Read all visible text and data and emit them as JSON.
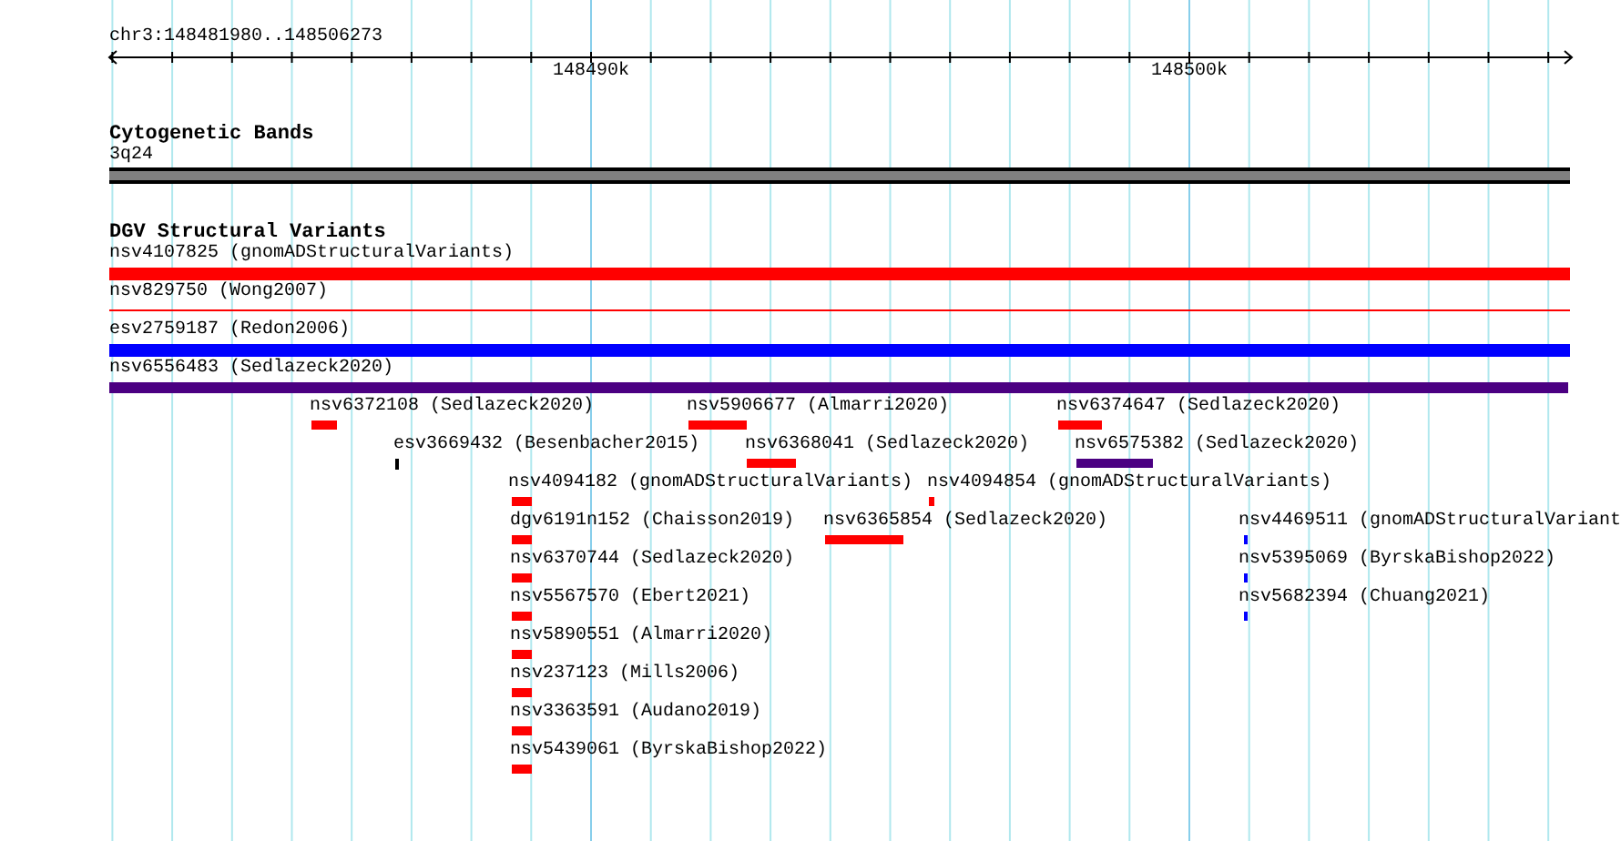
{
  "ruler": {
    "range": "chr3:148481980..148506273",
    "labels": [
      "148490k",
      "148500k"
    ]
  },
  "tracks": [
    {
      "title": "Cytogenetic Bands",
      "features": [
        {
          "label": "3q24",
          "color": "#808080",
          "kind": "band"
        }
      ]
    },
    {
      "title": "DGV Structural Variants",
      "features": [
        {
          "label": "nsv4107825 (gnomADStructuralVariants)",
          "color": "#ff0000",
          "kind": "bar"
        },
        {
          "label": "nsv829750 (Wong2007)",
          "color": "#ff0000",
          "kind": "line"
        },
        {
          "label": "esv2759187 (Redon2006)",
          "color": "#0000ff",
          "kind": "bar"
        },
        {
          "label": "nsv6556483 (Sedlazeck2020)",
          "color": "#4b0082",
          "kind": "bar"
        },
        {
          "label": "nsv6372108 (Sedlazeck2020)",
          "color": "#ff0000",
          "kind": "bar"
        },
        {
          "label": "nsv5906677 (Almarri2020)",
          "color": "#ff0000",
          "kind": "bar"
        },
        {
          "label": "nsv6374647 (Sedlazeck2020)",
          "color": "#ff0000",
          "kind": "bar"
        },
        {
          "label": "esv3669432 (Besenbacher2015)",
          "color": "#000000",
          "kind": "bar"
        },
        {
          "label": "nsv6368041 (Sedlazeck2020)",
          "color": "#ff0000",
          "kind": "bar"
        },
        {
          "label": "nsv6575382 (Sedlazeck2020)",
          "color": "#4b0082",
          "kind": "bar"
        },
        {
          "label": "nsv4094182 (gnomADStructuralVariants)",
          "color": "#ff0000",
          "kind": "bar"
        },
        {
          "label": "nsv4094854 (gnomADStructuralVariants)",
          "color": "#ff0000",
          "kind": "bar"
        },
        {
          "label": "dgv6191n152 (Chaisson2019)",
          "color": "#ff0000",
          "kind": "bar"
        },
        {
          "label": "nsv6365854 (Sedlazeck2020)",
          "color": "#ff0000",
          "kind": "bar"
        },
        {
          "label": "nsv4469511 (gnomADStructuralVariant",
          "color": "#0000ff",
          "kind": "bar"
        },
        {
          "label": "nsv6370744 (Sedlazeck2020)",
          "color": "#ff0000",
          "kind": "bar"
        },
        {
          "label": "nsv5395069 (ByrskaBishop2022)",
          "color": "#0000ff",
          "kind": "bar"
        },
        {
          "label": "nsv5567570 (Ebert2021)",
          "color": "#ff0000",
          "kind": "bar"
        },
        {
          "label": "nsv5682394 (Chuang2021)",
          "color": "#0000ff",
          "kind": "bar"
        },
        {
          "label": "nsv5890551 (Almarri2020)",
          "color": "#ff0000",
          "kind": "bar"
        },
        {
          "label": "nsv237123 (Mills2006)",
          "color": "#ff0000",
          "kind": "bar"
        },
        {
          "label": "nsv3363591 (Audano2019)",
          "color": "#ff0000",
          "kind": "bar"
        },
        {
          "label": "nsv5439061 (ByrskaBishop2022)",
          "color": "#ff0000",
          "kind": "bar"
        }
      ]
    }
  ]
}
